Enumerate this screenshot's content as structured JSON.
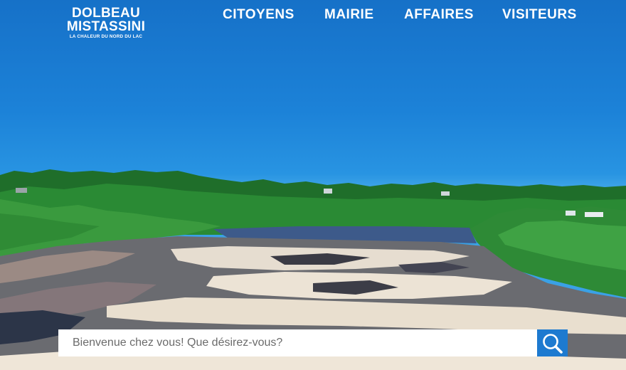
{
  "logo": {
    "line1": "DOLBEAU",
    "line2": "MISTASSINI",
    "tagline": "LA CHALEUR DU NORD DU LAC"
  },
  "nav": {
    "items": [
      {
        "label": "CITOYENS"
      },
      {
        "label": "MAIRIE"
      },
      {
        "label": "AFFAIRES"
      },
      {
        "label": "VISITEURS"
      }
    ]
  },
  "search": {
    "placeholder": "Bienvenue chez vous! Que désirez-vous?",
    "button_icon": "search-icon"
  },
  "colors": {
    "accent": "#1d7ad0",
    "sky": "#1c82d8",
    "text_on_hero": "#ffffff"
  }
}
